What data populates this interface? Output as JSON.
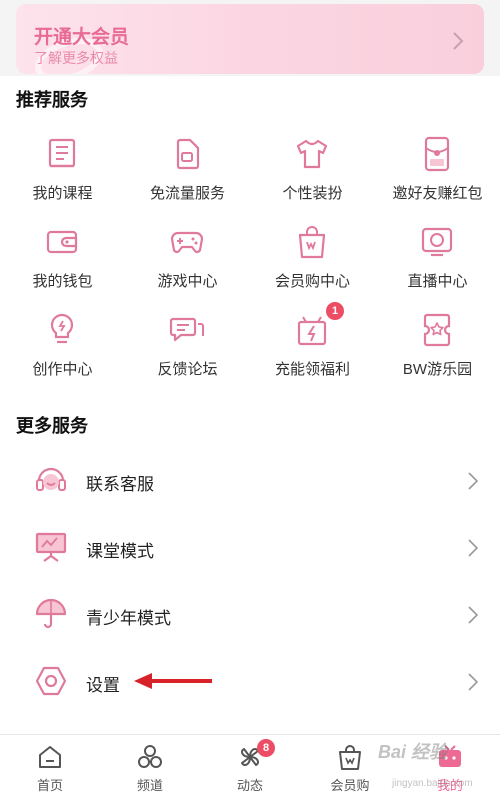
{
  "vip": {
    "title": "开通大会员",
    "subtitle": "了解更多权益"
  },
  "recommended": {
    "title": "推荐服务",
    "items": [
      {
        "label": "我的课程",
        "icon": "course-icon"
      },
      {
        "label": "免流量服务",
        "icon": "sim-card-icon"
      },
      {
        "label": "个性装扮",
        "icon": "tshirt-icon"
      },
      {
        "label": "邀好友赚红包",
        "icon": "red-packet-icon"
      },
      {
        "label": "我的钱包",
        "icon": "wallet-icon"
      },
      {
        "label": "游戏中心",
        "icon": "gamepad-icon"
      },
      {
        "label": "会员购中心",
        "icon": "shopping-bag-icon"
      },
      {
        "label": "直播中心",
        "icon": "live-tv-icon"
      },
      {
        "label": "创作中心",
        "icon": "lightbulb-icon"
      },
      {
        "label": "反馈论坛",
        "icon": "chat-bubbles-icon"
      },
      {
        "label": "充能领福利",
        "icon": "gift-bolt-icon",
        "badge": "1"
      },
      {
        "label": "BW游乐园",
        "icon": "ticket-icon"
      }
    ]
  },
  "more": {
    "title": "更多服务",
    "items": [
      {
        "label": "联系客服",
        "icon": "headset-icon"
      },
      {
        "label": "课堂模式",
        "icon": "presentation-board-icon"
      },
      {
        "label": "青少年模式",
        "icon": "umbrella-icon"
      },
      {
        "label": "设置",
        "icon": "hexagon-settings-icon"
      }
    ]
  },
  "tabs": [
    {
      "label": "首页",
      "icon": "home-icon"
    },
    {
      "label": "频道",
      "icon": "channels-icon"
    },
    {
      "label": "动态",
      "icon": "pinwheel-icon",
      "badge": "8"
    },
    {
      "label": "会员购",
      "icon": "shopping-bag-icon"
    },
    {
      "label": "我的",
      "icon": "tv-icon",
      "active": true
    }
  ],
  "watermark": {
    "text": "Bai 经验",
    "sub": "jingyan.baidu.com"
  },
  "colors": {
    "accent": "#ec6a93",
    "icon_stroke": "#e07a9b",
    "badge": "#ec4d64",
    "vip_bg": "#fde3ec"
  }
}
